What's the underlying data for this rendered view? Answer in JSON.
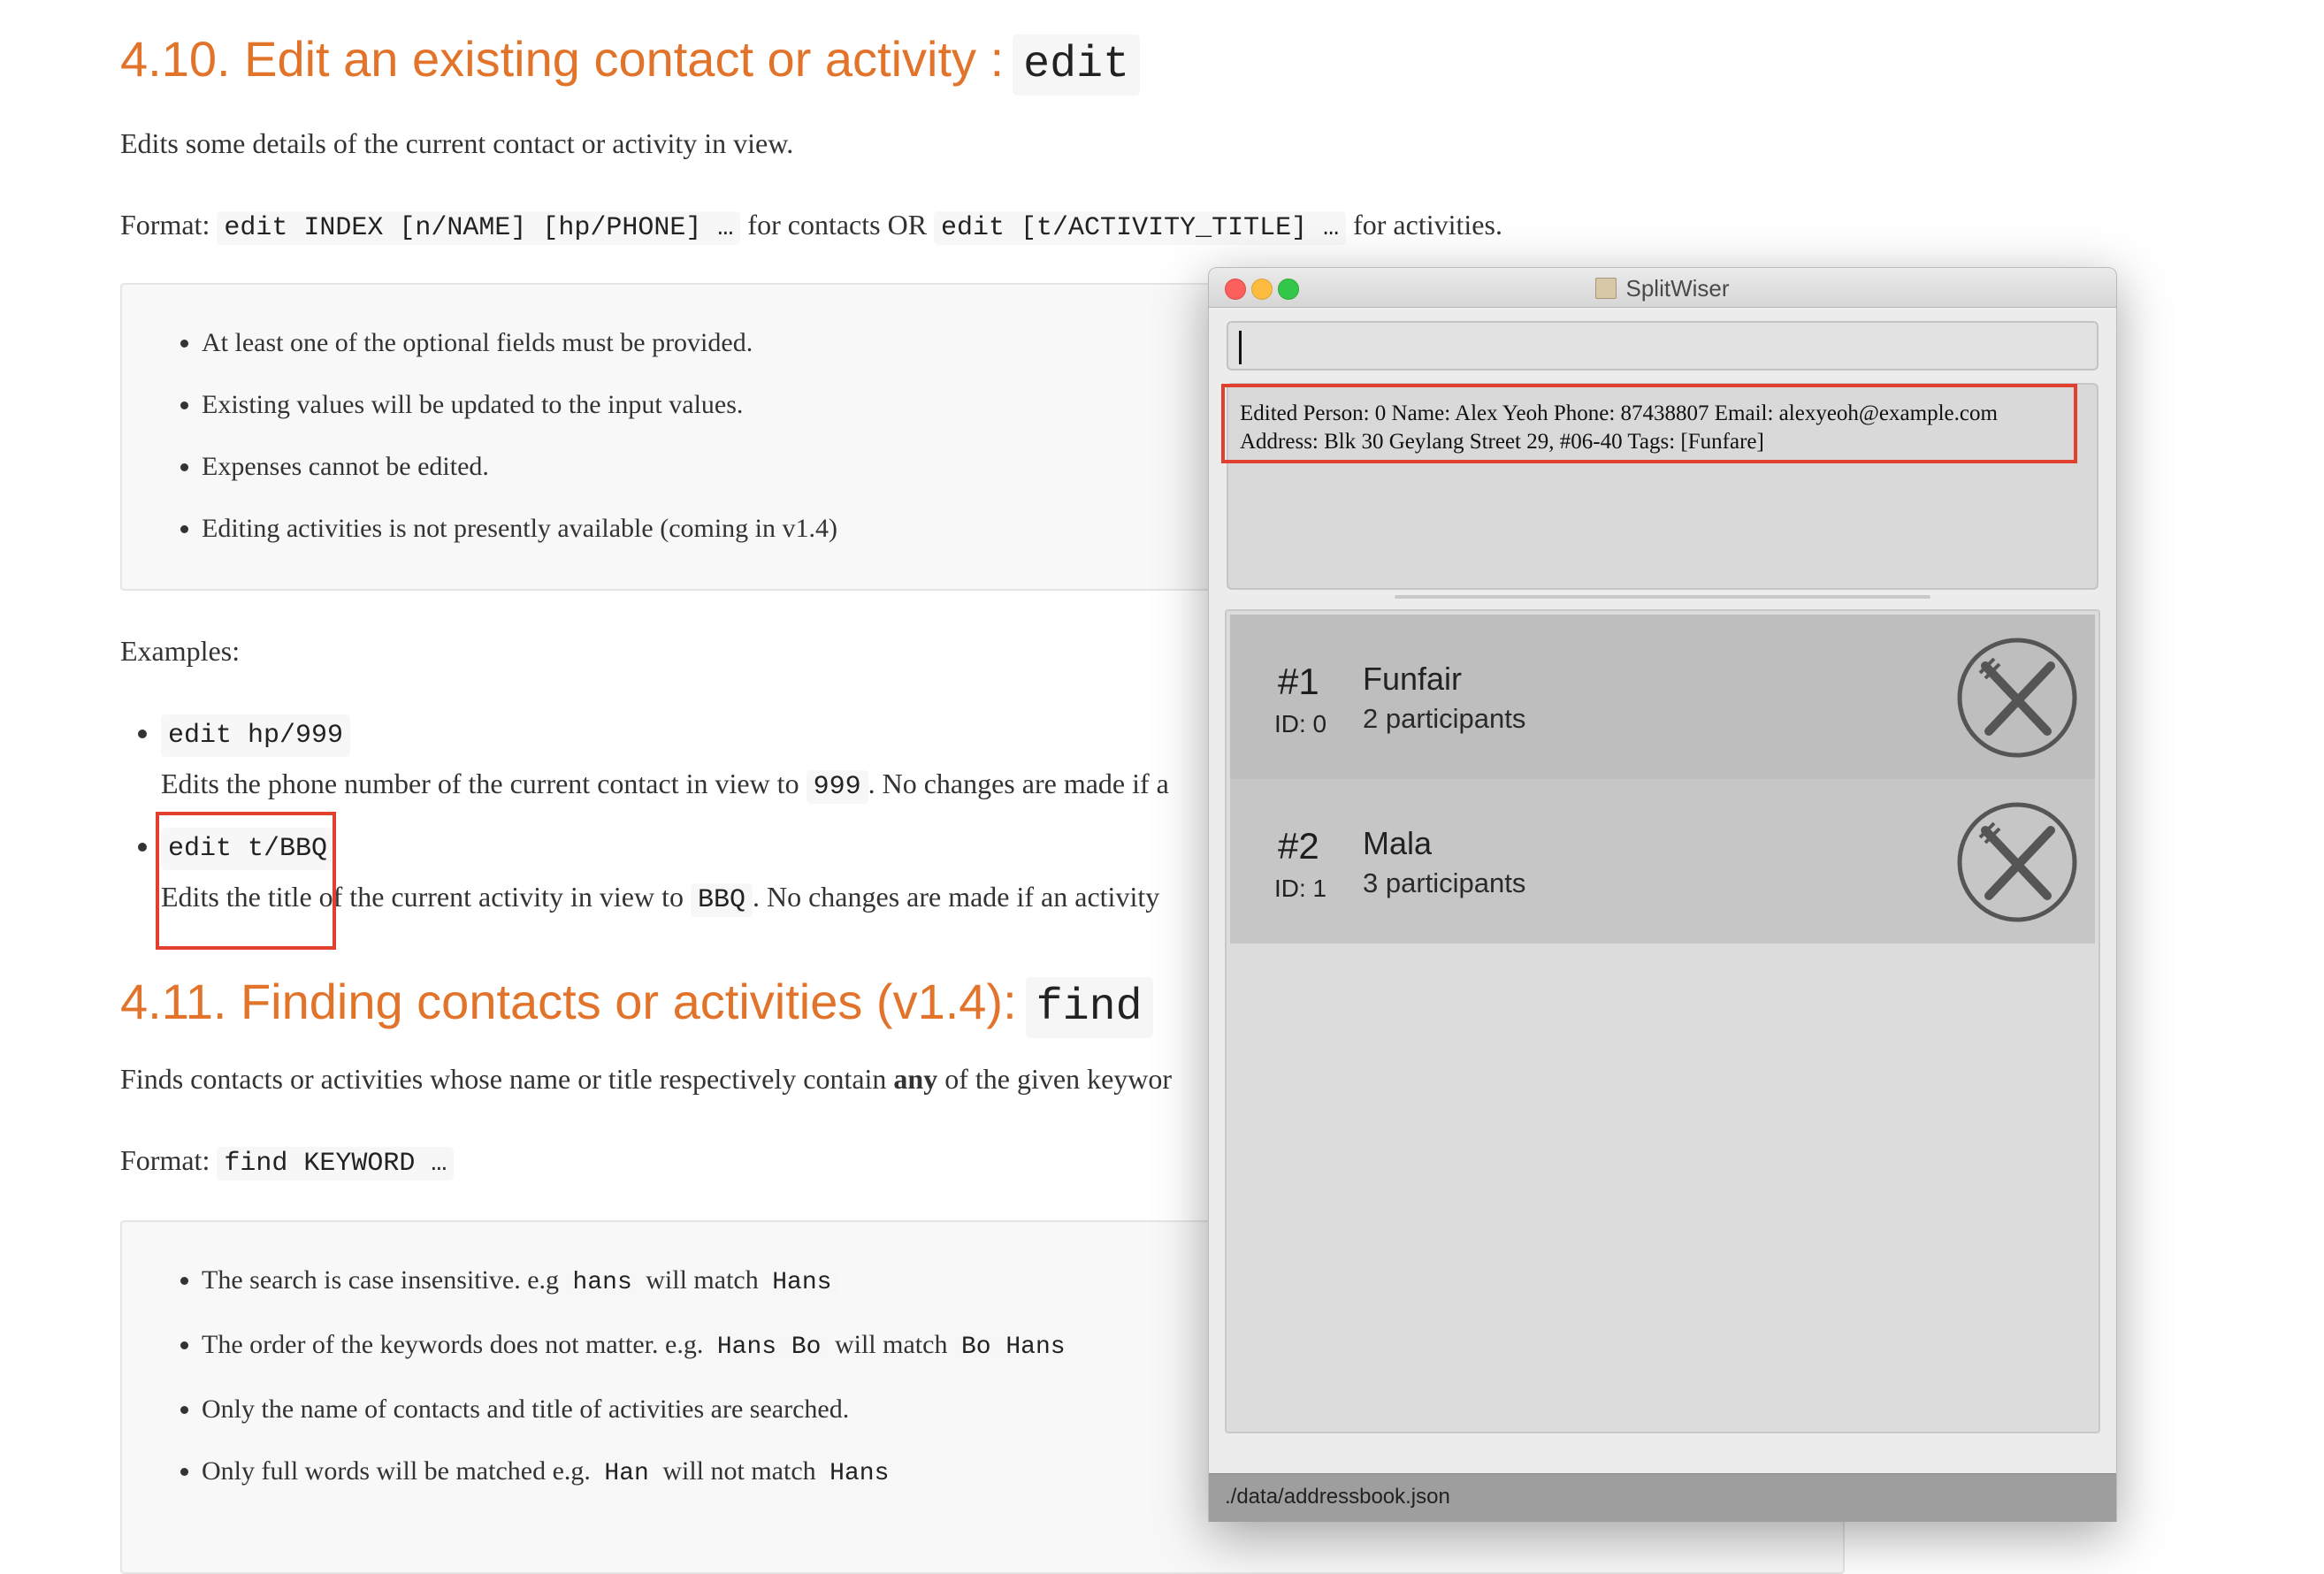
{
  "doc": {
    "section_410": {
      "heading_text": "4.10. Edit an existing contact or activity :",
      "heading_code": "edit",
      "intro": "Edits some details of the current contact or activity in view.",
      "format_label": "Format:",
      "format_code_1": "edit INDEX [n/NAME] [hp/PHONE] …",
      "format_middle": "for contacts OR",
      "format_code_2": "edit [t/ACTIVITY_TITLE] …",
      "format_end": "for activities.",
      "notes": [
        "At least one of the optional fields must be provided.",
        "Existing values will be updated to the input values.",
        "Expenses cannot be edited.",
        "Editing activities is not presently available (coming in v1.4)"
      ],
      "examples_label": "Examples:",
      "examples": [
        {
          "command": "edit hp/999",
          "desc_pre": "Edits the phone number of the current contact in view to",
          "desc_code": "999",
          "desc_post": ". No changes are made if a"
        },
        {
          "command": "edit t/BBQ",
          "desc_pre": "Edits the title of the current activity in view to",
          "desc_code": "BBQ",
          "desc_post": ". No changes are made if an activity"
        }
      ]
    },
    "section_411": {
      "heading_text": "4.11. Finding contacts or activities (v1.4):",
      "heading_code": "find",
      "intro_pre": "Finds contacts or activities whose name or title respectively contain",
      "intro_bold": "any",
      "intro_post": "of the given keywor",
      "format_label": "Format:",
      "format_code": "find KEYWORD …",
      "notes": [
        {
          "pre": "The search is case insensitive. e.g",
          "code1": "hans",
          "mid": "will match",
          "code2": "Hans"
        },
        {
          "pre": "The order of the keywords does not matter. e.g.",
          "code1": "Hans Bo",
          "mid": "will match",
          "code2": "Bo Hans"
        },
        {
          "pre": "Only the name of contacts and title of activities are searched.",
          "code1": "",
          "mid": "",
          "code2": ""
        },
        {
          "pre": "Only full words will be matched e.g.",
          "code1": "Han",
          "mid": "will not match",
          "code2": "Hans"
        }
      ]
    }
  },
  "app": {
    "window_title": "SplitWiser",
    "command_input_value": "",
    "result_message": "Edited Person: 0 Name: Alex Yeoh Phone: 87438807 Email: alexyeoh@example.com\nAddress: Blk 30 Geylang Street 29, #06-40 Tags: [Funfare]",
    "activities": [
      {
        "index": "#1",
        "id_label": "ID: 0",
        "title": "Funfair",
        "participants": "2 participants",
        "icon": "fork-knife-icon"
      },
      {
        "index": "#2",
        "id_label": "ID: 1",
        "title": "Mala",
        "participants": "3 participants",
        "icon": "fork-knife-icon"
      }
    ],
    "status_path": "./data/addressbook.json"
  },
  "colors": {
    "heading": "#e2732a",
    "annotation_box": "#e0402d",
    "traffic_close": "#fc605c",
    "traffic_minimize": "#fdbc40",
    "traffic_maximize": "#34c84a"
  }
}
